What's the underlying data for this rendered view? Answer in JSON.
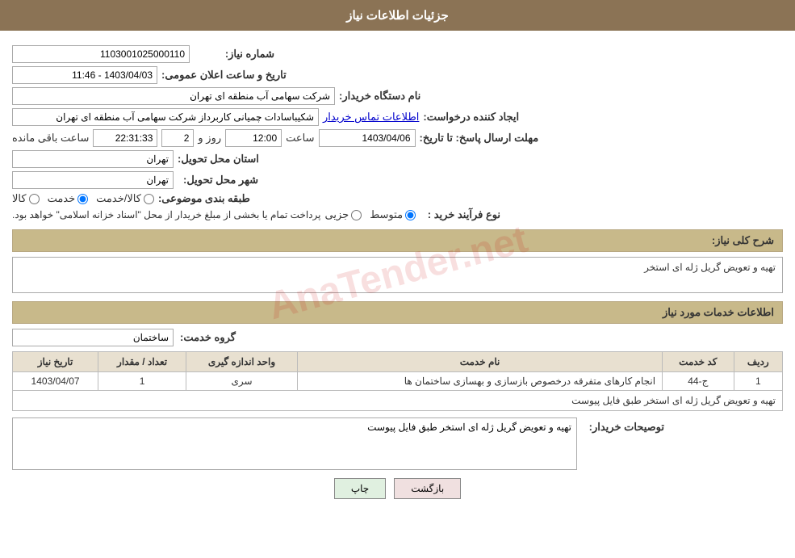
{
  "header": {
    "title": "جزئیات اطلاعات نیاز"
  },
  "fields": {
    "shomare_niaz_label": "شماره نیاز:",
    "shomare_niaz_value": "1103001025000110",
    "tarikh_label": "تاریخ و ساعت اعلان عمومی:",
    "tarikh_value": "1403/04/03 - 11:46",
    "nam_dastgah_label": "نام دستگاه خریدار:",
    "nam_dastgah_value": "شرکت سهامی آب منطقه ای تهران",
    "ijad_label": "ایجاد کننده درخواست:",
    "ijad_value": "شکیباسادات چمیانی کاربرداز شرکت سهامی آب منطقه ای تهران",
    "ijad_link": "اطلاعات تماس خریدار",
    "mohlat_label": "مهلت ارسال پاسخ: تا تاریخ:",
    "mohlat_date": "1403/04/06",
    "mohlat_saat_label": "ساعت",
    "mohlat_saat_value": "12:00",
    "mohlat_roz_label": "روز و",
    "mohlat_roz_value": "2",
    "mohlat_mande_value": "22:31:33",
    "mohlat_mande_label": "ساعت باقی مانده",
    "ostan_label": "استان محل تحویل:",
    "ostan_value": "تهران",
    "shahr_label": "شهر محل تحویل:",
    "shahr_value": "تهران",
    "tabagheh_label": "طبقه بندی موضوعی:",
    "tabagheh_options": [
      "کالا",
      "خدمت",
      "کالا/خدمت"
    ],
    "tabagheh_selected": "خدمت",
    "navoe_label": "نوع فرآیند خرید :",
    "navoe_options": [
      "جزیی",
      "متوسط"
    ],
    "navoe_selected": "متوسط",
    "navoe_note": "پرداخت تمام یا بخشی از مبلغ خریدار از محل \"اسناد خزانه اسلامی\" خواهد بود.",
    "sharh_label": "شرح کلی نیاز:",
    "sharh_value": "تهیه و تعویض گریل ژله ای استخر",
    "khadamat_title": "اطلاعات خدمات مورد نیاز",
    "grohe_label": "گروه خدمت:",
    "grohe_value": "ساختمان",
    "table_headers": [
      "ردیف",
      "کد خدمت",
      "نام خدمت",
      "واحد اندازه گیری",
      "تعداد / مقدار",
      "تاریخ نیاز"
    ],
    "table_rows": [
      {
        "radif": "1",
        "kod": "ج-44",
        "nam": "انجام کارهای متفرقه درخصوص بازسازی و بهسازی ساختمان ها",
        "vahed": "سری",
        "tedad": "1",
        "tarikh": "1403/04/07"
      }
    ],
    "table_description": "تهیه و تعویض گریل ژله ای استخر طبق فایل پیوست",
    "tosihaat_label": "توصیحات خریدار:",
    "tosihaat_value": "تهیه و تعویض گریل ژله ای استخر طبق فایل پیوست",
    "btn_print": "چاپ",
    "btn_back": "بازگشت"
  }
}
